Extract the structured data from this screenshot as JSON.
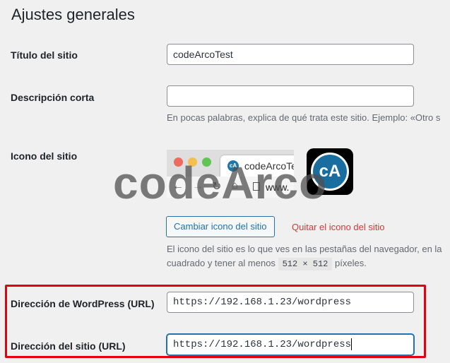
{
  "page_title": "Ajustes generales",
  "site_title": {
    "label": "Título del sitio",
    "value": "codeArcoTest"
  },
  "tagline": {
    "label": "Descripción corta",
    "value": "",
    "description": "En pocas palabras, explica de qué trata este sitio. Ejemplo: «Otro s"
  },
  "site_icon": {
    "label": "Icono del sitio",
    "browser_tab_title": "codeArcoTe",
    "favicon_text": "cA",
    "address_text": "www.",
    "big_icon_text": "cA",
    "change_button": "Cambiar icono del sitio",
    "remove_link": "Quitar el icono del sitio",
    "description_line1": "El icono del sitio es lo que ves en las pestañas del navegador, en la",
    "description_line2_pre": "cuadrado y tener al menos",
    "size_code": "512 × 512",
    "description_line2_post": "píxeles."
  },
  "watermark": "codeArco",
  "wordpress_url": {
    "label": "Dirección de WordPress (URL)",
    "value": "https://192.168.1.23/wordpress"
  },
  "site_url": {
    "label": "Dirección del sitio (URL)",
    "value": "https://192.168.1.23/wordpress"
  },
  "colors": {
    "accent": "#2271b1",
    "danger": "#d63638",
    "highlight_box": "#e3000f"
  }
}
